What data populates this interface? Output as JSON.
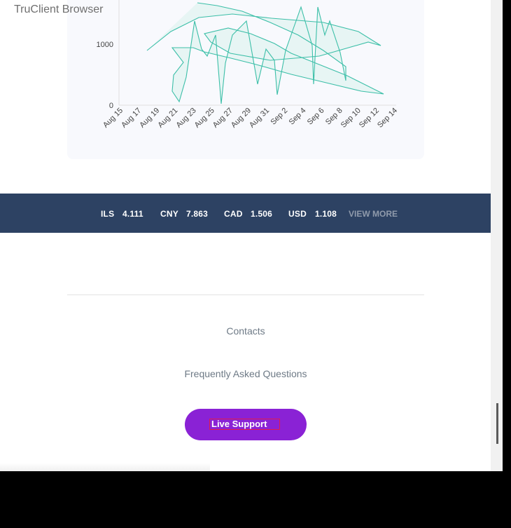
{
  "browser": {
    "label": "TruClient Browser"
  },
  "chart_data": {
    "type": "area",
    "ylabel_ticks": [
      "0",
      "1000"
    ],
    "x_ticks": [
      "Aug 15",
      "Aug 17",
      "Aug 19",
      "Aug 21",
      "Aug 23",
      "Aug 25",
      "Aug 27",
      "Aug 29",
      "Aug 31",
      "Sep 2",
      "Sep 4",
      "Sep 6",
      "Sep 8",
      "Sep 10",
      "Sep 12",
      "Sep 14"
    ],
    "ylim": [
      0,
      1950
    ],
    "colors": {
      "line": "#3cbfa8",
      "fill": "#d9f2ec",
      "axis": "#e0e0e0",
      "tick": "#444444"
    }
  },
  "ticker": {
    "items": [
      {
        "code": "ILS",
        "value": "4.111"
      },
      {
        "code": "CNY",
        "value": "7.863"
      },
      {
        "code": "CAD",
        "value": "1.506"
      },
      {
        "code": "USD",
        "value": "1.108"
      }
    ],
    "view_more": "VIEW MORE"
  },
  "footer": {
    "contacts": "Contacts",
    "faq": "Frequently Asked Questions",
    "live_support": "Live Support"
  }
}
